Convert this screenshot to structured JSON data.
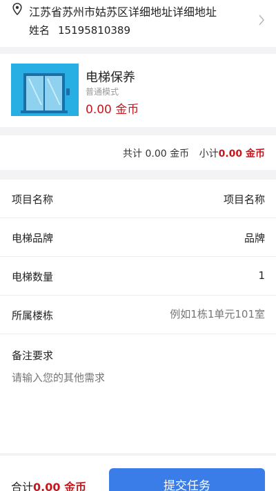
{
  "address": {
    "line": "江苏省苏州市姑苏区详细地址详细地址",
    "name": "姓名",
    "phone": "15195810389"
  },
  "product": {
    "name": "电梯保养",
    "mode": "普通模式",
    "price": "0.00 金币"
  },
  "totals": {
    "total_label": "共计",
    "total_value": "0.00 金币",
    "subtotal_label": "小计",
    "subtotal_value": "0.00 金币"
  },
  "form": {
    "rows": [
      {
        "label": "项目名称",
        "value": "项目名称"
      },
      {
        "label": "电梯品牌",
        "value": "品牌"
      },
      {
        "label": "电梯数量",
        "value": "1"
      },
      {
        "label": "所属楼栋",
        "placeholder": "例如1栋1单元101室"
      }
    ],
    "remark_label": "备注要求",
    "remark_placeholder": "请输入您的其他需求"
  },
  "bottom": {
    "total_label": "合计",
    "total_value": "0.00 金币",
    "submit_label": "提交任务"
  },
  "colors": {
    "accent_red": "#c8161d",
    "button_blue": "#3a7de8",
    "thumb_blue": "#27aee2"
  },
  "icons": {
    "location": "location-pin-icon",
    "chevron": "chevron-right-icon",
    "elevator": "elevator-icon"
  }
}
